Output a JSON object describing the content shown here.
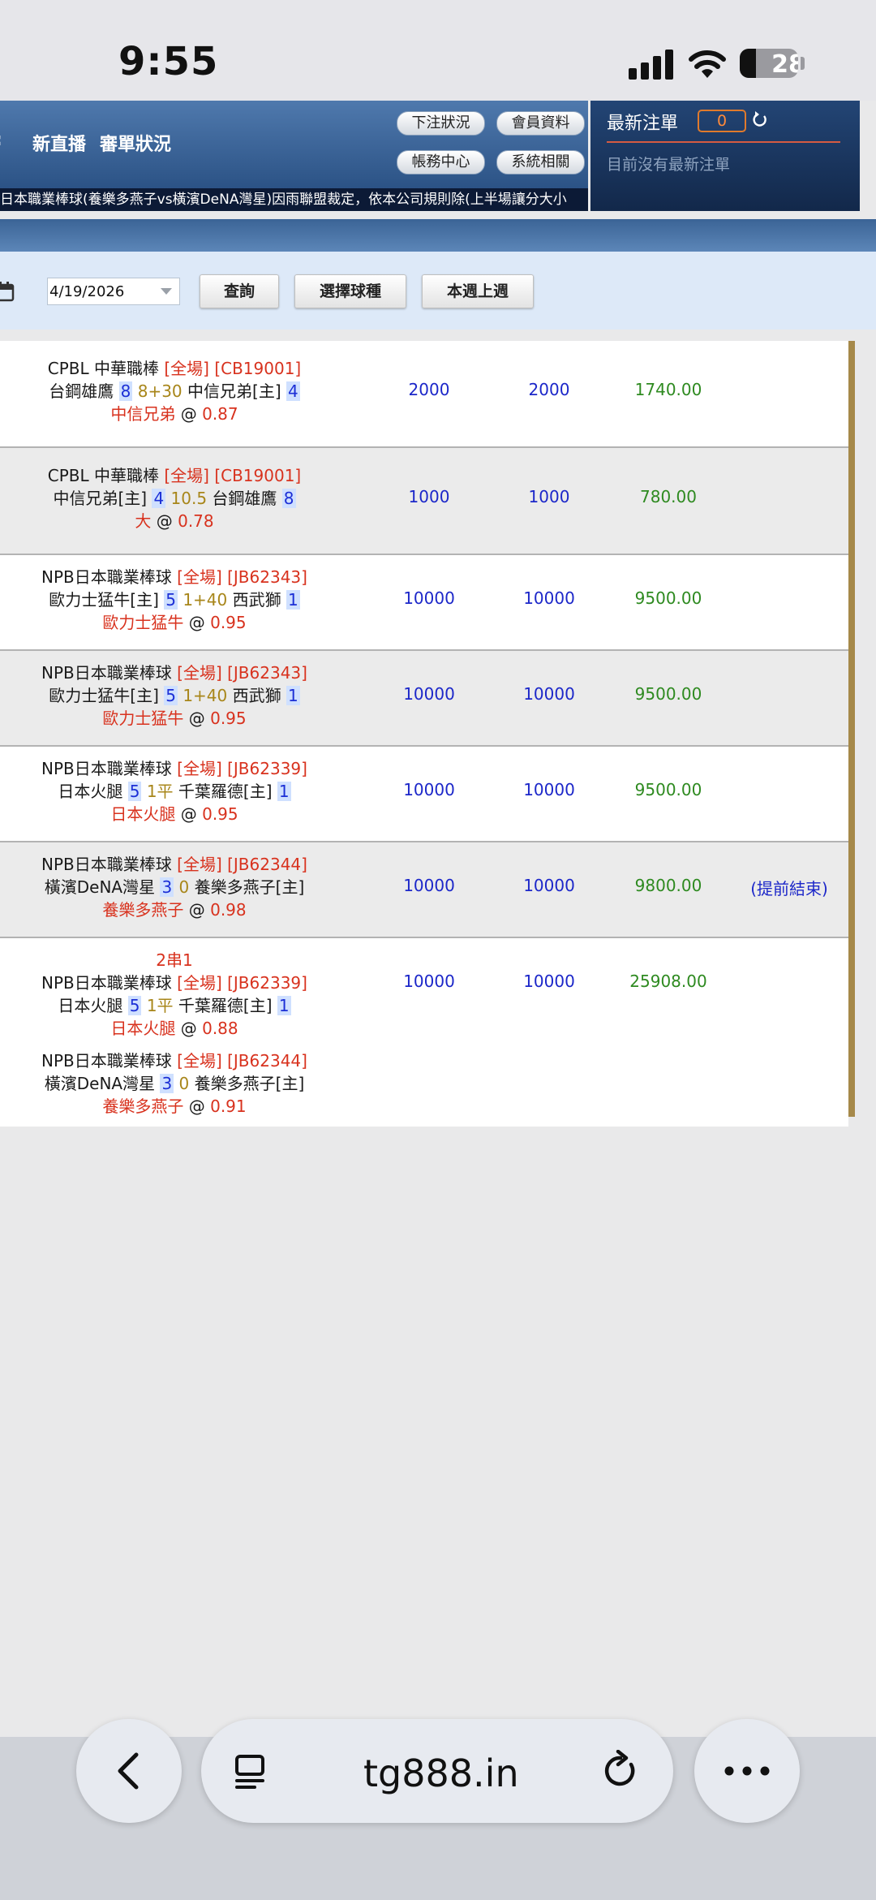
{
  "status_bar": {
    "time": "9:55",
    "battery": "28",
    "battery_level": 0.28
  },
  "header": {
    "nav": [
      "新直播",
      "審單狀況"
    ],
    "buttons": [
      "下注狀況",
      "會員資料",
      "帳務中心",
      "系統相關"
    ],
    "ticker": "日本職業棒球(養樂多燕子vs橫濱DeNA灣星)因雨聯盟裁定，依本公司規則除(上半場讓分大小"
  },
  "latest_bets": {
    "title": "最新注單",
    "count": "0",
    "empty_text": "目前沒有最新注單"
  },
  "filter": {
    "date": "4/19/2026",
    "query_button": "查詢",
    "select_sport_button": "選擇球種",
    "week_button": "本週上週"
  },
  "bets": [
    {
      "league": "CPBL 中華職棒",
      "tag": "[全場] [CB19001]",
      "team_a": "台鋼雄鷹",
      "score_a": "8",
      "line": "8+30",
      "team_b": "中信兄弟[主]",
      "score_b": "4",
      "pick": "中信兄弟",
      "odds": "0.87",
      "stake": "2000",
      "valid": "2000",
      "result": "1740.00",
      "note": ""
    },
    {
      "league": "CPBL 中華職棒",
      "tag": "[全場] [CB19001]",
      "team_a": "中信兄弟[主]",
      "score_a": "4",
      "line": "10.5",
      "team_b": "台鋼雄鷹",
      "score_b": "8",
      "pick": "大",
      "odds": "0.78",
      "stake": "1000",
      "valid": "1000",
      "result": "780.00",
      "note": ""
    },
    {
      "league": "NPB日本職業棒球",
      "tag": "[全場] [JB62343]",
      "team_a": "歐力士猛牛[主]",
      "score_a": "5",
      "line": "1+40",
      "team_b": "西武獅",
      "score_b": "1",
      "pick": "歐力士猛牛",
      "odds": "0.95",
      "stake": "10000",
      "valid": "10000",
      "result": "9500.00",
      "note": ""
    },
    {
      "league": "NPB日本職業棒球",
      "tag": "[全場] [JB62343]",
      "team_a": "歐力士猛牛[主]",
      "score_a": "5",
      "line": "1+40",
      "team_b": "西武獅",
      "score_b": "1",
      "pick": "歐力士猛牛",
      "odds": "0.95",
      "stake": "10000",
      "valid": "10000",
      "result": "9500.00",
      "note": ""
    },
    {
      "league": "NPB日本職業棒球",
      "tag": "[全場] [JB62339]",
      "team_a": "日本火腿",
      "score_a": "5",
      "line": "1平",
      "team_b": "千葉羅德[主]",
      "score_b": "1",
      "pick": "日本火腿",
      "odds": "0.95",
      "stake": "10000",
      "valid": "10000",
      "result": "9500.00",
      "note": ""
    },
    {
      "league": "NPB日本職業棒球",
      "tag": "[全場] [JB62344]",
      "team_a": "橫濱DeNA灣星",
      "score_a": "3",
      "line": "0",
      "team_b": "養樂多燕子[主]",
      "score_b": "",
      "pick": "養樂多燕子",
      "odds": "0.98",
      "stake": "10000",
      "valid": "10000",
      "result": "9800.00",
      "note": "(提前結束)"
    }
  ],
  "parlay": {
    "label": "2串1",
    "stake": "10000",
    "valid": "10000",
    "result": "25908.00",
    "legs": [
      {
        "league": "NPB日本職業棒球",
        "tag": "[全場] [JB62339]",
        "team_a": "日本火腿",
        "score_a": "5",
        "line": "1平",
        "team_b": "千葉羅德[主]",
        "score_b": "1",
        "pick": "日本火腿",
        "odds": "0.88"
      },
      {
        "league": "NPB日本職業棒球",
        "tag": "[全場] [JB62344]",
        "team_a": "橫濱DeNA灣星",
        "score_a": "3",
        "line": "0",
        "team_b": "養樂多燕子[主]",
        "score_b": "",
        "pick": "養樂多燕子",
        "odds": "0.91"
      }
    ]
  },
  "browser": {
    "url": "tg888.in"
  },
  "colors": {
    "header_blue": "#2a5184",
    "pick_red": "#d8321e",
    "amount_blue": "#1c27c9",
    "result_green": "#2e8a20",
    "line_gold": "#a8861a"
  }
}
